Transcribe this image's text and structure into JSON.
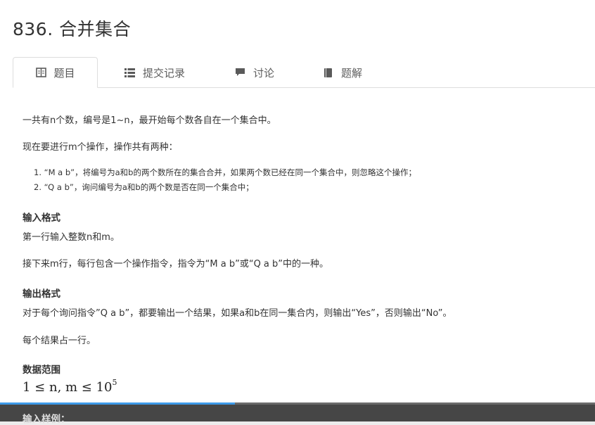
{
  "page": {
    "title": "836. 合并集合"
  },
  "tabs": [
    {
      "label": "题目",
      "icon": "book-icon",
      "active": true
    },
    {
      "label": "提交记录",
      "icon": "list-icon",
      "active": false
    },
    {
      "label": "讨论",
      "icon": "comment-icon",
      "active": false
    },
    {
      "label": "题解",
      "icon": "solution-book-icon",
      "active": false
    }
  ],
  "problem": {
    "intro": "一共有n个数，编号是1~n，最开始每个数各自在一个集合中。",
    "ops_intro": "现在要进行m个操作，操作共有两种：",
    "ops": [
      "1. “M a b”，将编号为a和b的两个数所在的集合合并，如果两个数已经在同一个集合中，则忽略这个操作；",
      "2. “Q a b”，询问编号为a和b的两个数是否在同一个集合中；"
    ],
    "input_heading": "输入格式",
    "input_line1": "第一行输入整数n和m。",
    "input_line2": "接下来m行，每行包含一个操作指令，指令为“M a b”或“Q a b”中的一种。",
    "output_heading": "输出格式",
    "output_line1": "对于每个询问指令”Q a b”，都要输出一个结果，如果a和b在同一集合内，则输出“Yes”，否则输出“No”。",
    "output_line2": "每个结果占一行。",
    "range_heading": "数据范围",
    "range_math": "1 ≤ n, m ≤ 10",
    "range_exp": "5",
    "sample_heading": "输入样例："
  },
  "video": {
    "progress_fraction": 0.395
  },
  "colors": {
    "progress": "#3d9ae8",
    "bar": "#3a3a3a"
  }
}
